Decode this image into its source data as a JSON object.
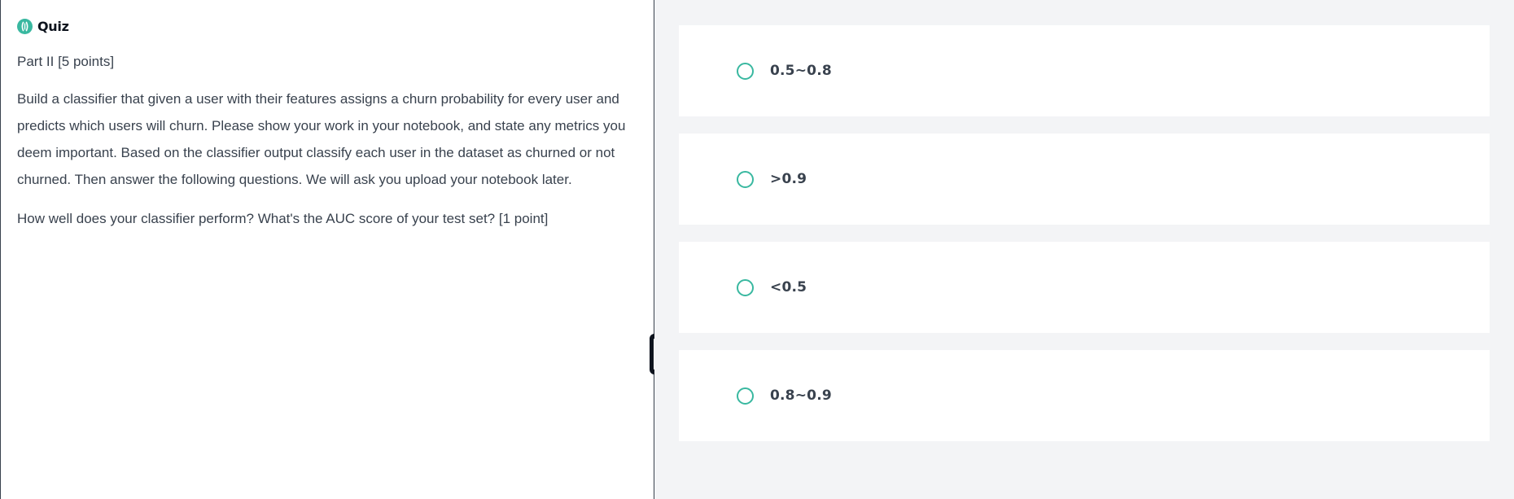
{
  "quiz": {
    "icon": "quiz-icon",
    "title": "Quiz"
  },
  "content": {
    "part_heading": "Part II [5 points]",
    "description": "Build a classifier that given a user with their features assigns a churn probability for every user and predicts which users will churn. Please show your work in your notebook, and state any metrics you deem important. Based on the classifier output classify each user in the dataset as churned or not churned. Then answer the following questions. We will ask you upload your notebook later.",
    "question": "How well does your classifier perform? What's the AUC score of your test set? [1 point]"
  },
  "options": [
    {
      "label": "0.5~0.8"
    },
    {
      "label": ">0.9"
    },
    {
      "label": "<0.5"
    },
    {
      "label": "0.8~0.9"
    }
  ],
  "colors": {
    "accent": "#39b8a0",
    "text": "#39424e",
    "right_background": "#f3f4f6"
  }
}
